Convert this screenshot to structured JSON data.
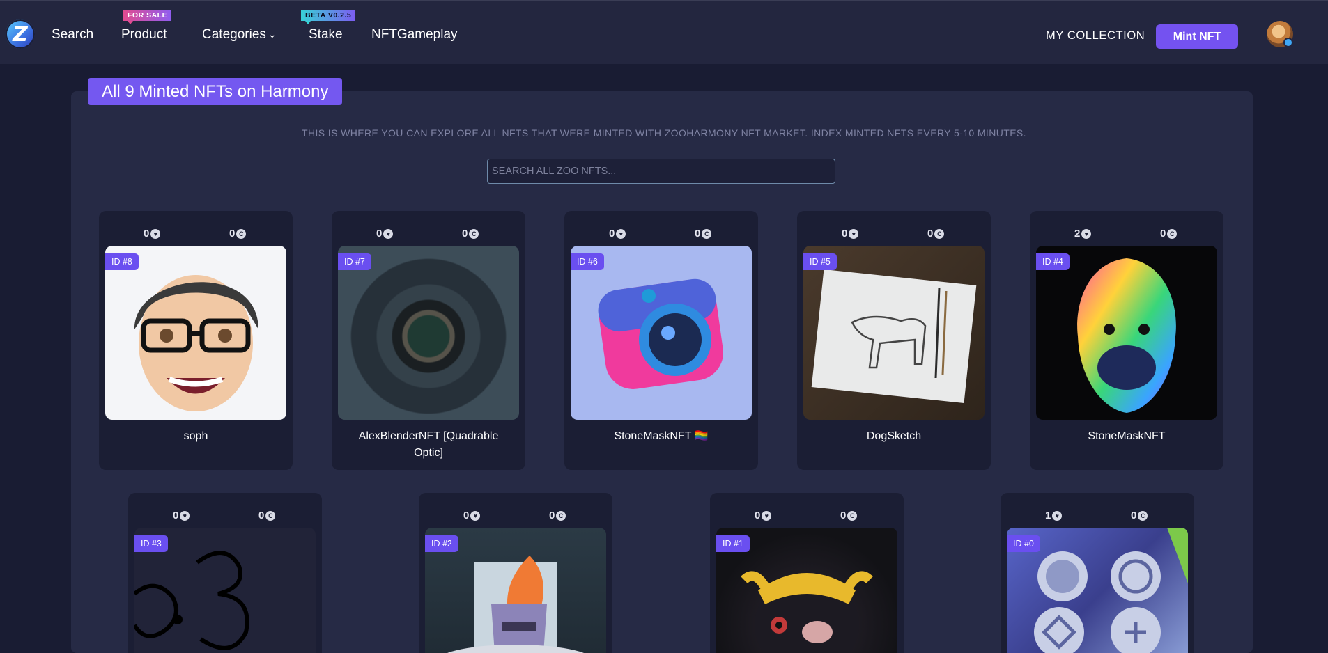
{
  "nav": {
    "logo_letter": "Z",
    "links": [
      "Search",
      "Product",
      "Categories",
      "Stake",
      "NFTGameplay"
    ],
    "product_tag": "FOR SALE",
    "stake_tag": "BETA V0.2.5",
    "my_collection": "MY COLLECTION",
    "mint_button": "Mint NFT"
  },
  "panel": {
    "title": "All 9 Minted NFTs on Harmony",
    "subtitle": "THIS IS WHERE YOU CAN EXPLORE ALL NFTS THAT WERE MINTED WITH ZOOHARMONY NFT MARKET. INDEX MINTED NFTS EVERY 5-10 MINUTES.",
    "search_placeholder": "SEARCH ALL ZOO NFTS..."
  },
  "cards": [
    {
      "id": "ID #8",
      "likes": "0",
      "coins": "0",
      "name": "soph"
    },
    {
      "id": "ID #7",
      "likes": "0",
      "coins": "0",
      "name": "AlexBlenderNFT [Quadrable Optic]"
    },
    {
      "id": "ID #6",
      "likes": "0",
      "coins": "0",
      "name": "StoneMaskNFT 🏳️‍🌈"
    },
    {
      "id": "ID #5",
      "likes": "0",
      "coins": "0",
      "name": "DogSketch"
    },
    {
      "id": "ID #4",
      "likes": "2",
      "coins": "0",
      "name": "StoneMaskNFT"
    },
    {
      "id": "ID #3",
      "likes": "0",
      "coins": "0",
      "name": ""
    },
    {
      "id": "ID #2",
      "likes": "0",
      "coins": "0",
      "name": ""
    },
    {
      "id": "ID #1",
      "likes": "0",
      "coins": "0",
      "name": ""
    },
    {
      "id": "ID #0",
      "likes": "1",
      "coins": "0",
      "name": ""
    }
  ],
  "icons": {
    "heart": "heart-icon",
    "coin": "coin-icon"
  },
  "colors": {
    "accent": "#7452f0",
    "background": "#191c33",
    "panel": "#262a45",
    "card": "#1b1e34"
  }
}
